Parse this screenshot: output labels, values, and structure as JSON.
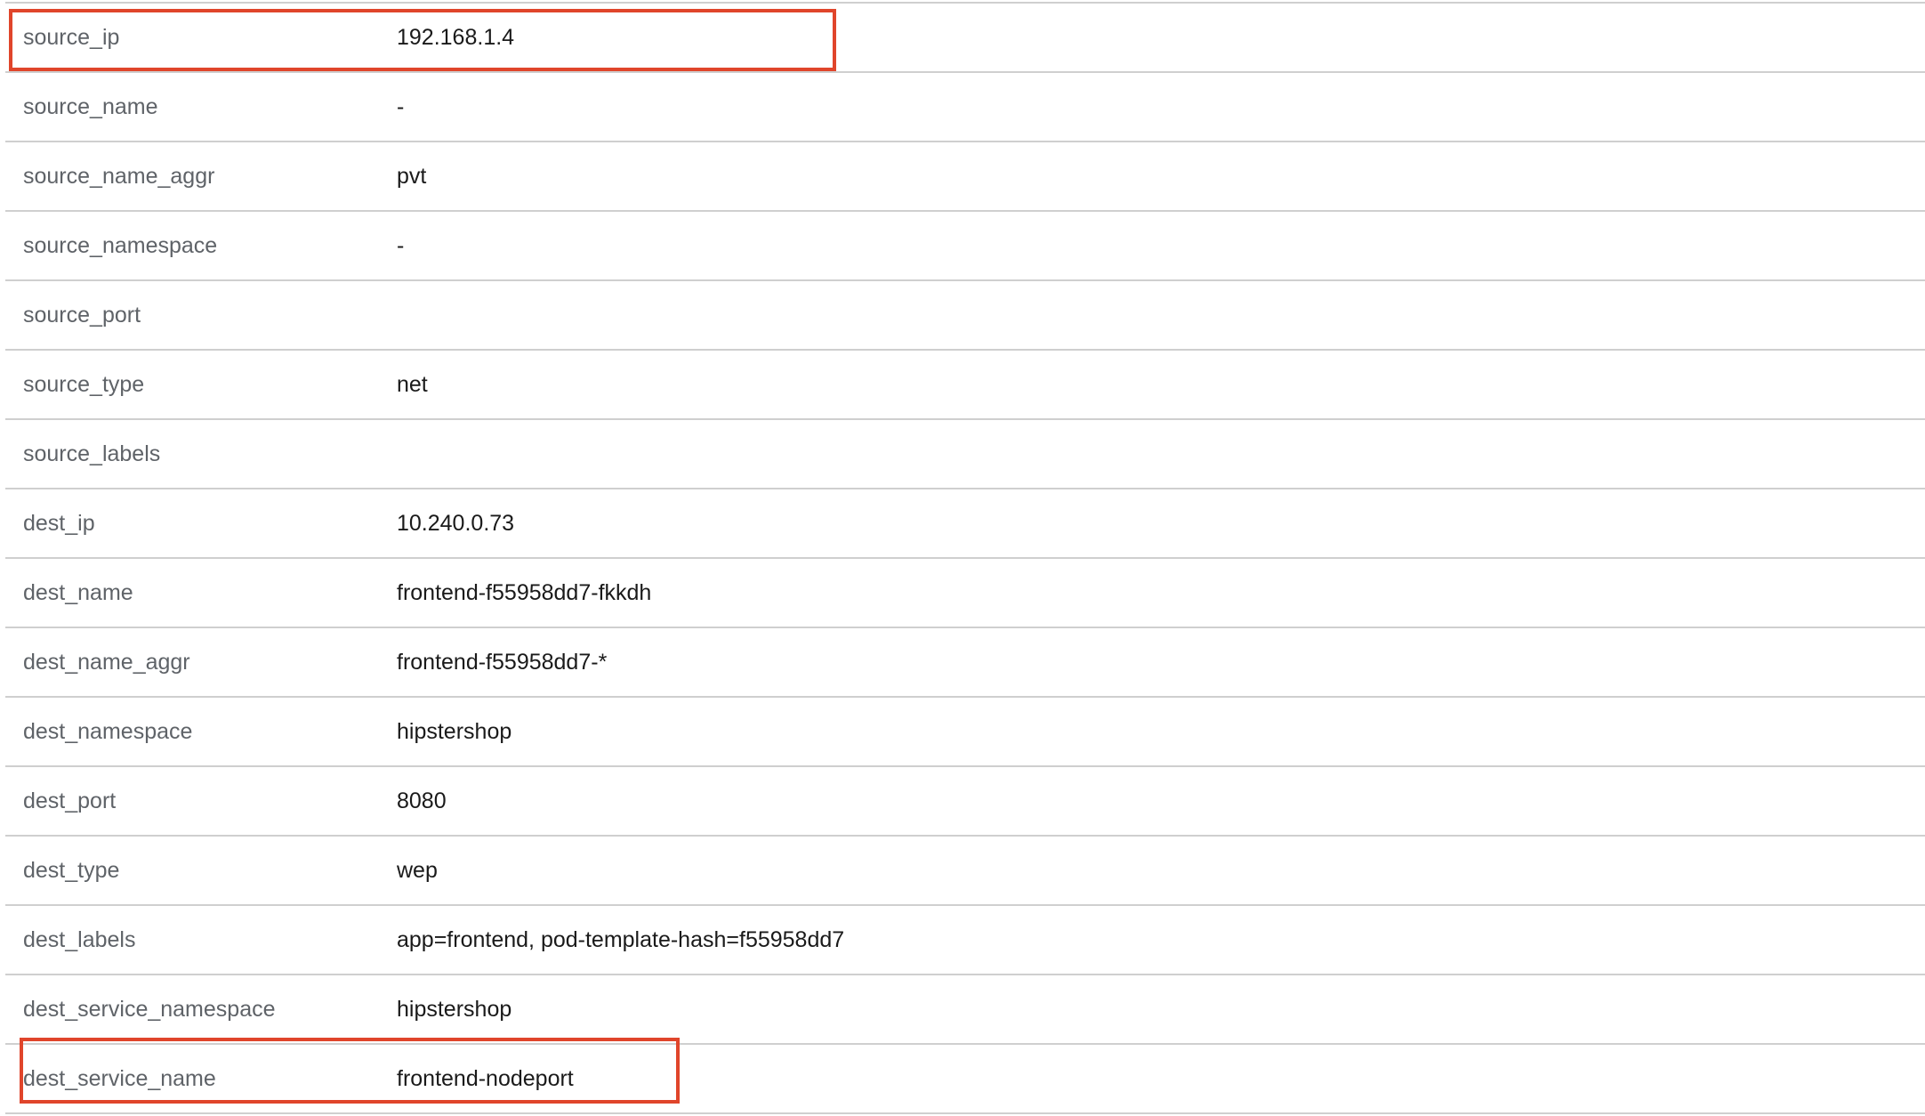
{
  "rows": [
    {
      "key": "source_ip",
      "value": "192.168.1.4"
    },
    {
      "key": "source_name",
      "value": "-"
    },
    {
      "key": "source_name_aggr",
      "value": "pvt"
    },
    {
      "key": "source_namespace",
      "value": "-"
    },
    {
      "key": "source_port",
      "value": ""
    },
    {
      "key": "source_type",
      "value": "net"
    },
    {
      "key": "source_labels",
      "value": ""
    },
    {
      "key": "dest_ip",
      "value": "10.240.0.73"
    },
    {
      "key": "dest_name",
      "value": "frontend-f55958dd7-fkkdh"
    },
    {
      "key": "dest_name_aggr",
      "value": "frontend-f55958dd7-*"
    },
    {
      "key": "dest_namespace",
      "value": "hipstershop"
    },
    {
      "key": "dest_port",
      "value": "8080"
    },
    {
      "key": "dest_type",
      "value": "wep"
    },
    {
      "key": "dest_labels",
      "value": "app=frontend, pod-template-hash=f55958dd7"
    },
    {
      "key": "dest_service_namespace",
      "value": "hipstershop"
    },
    {
      "key": "dest_service_name",
      "value": "frontend-nodeport"
    }
  ],
  "highlight_color": "#e0452b"
}
